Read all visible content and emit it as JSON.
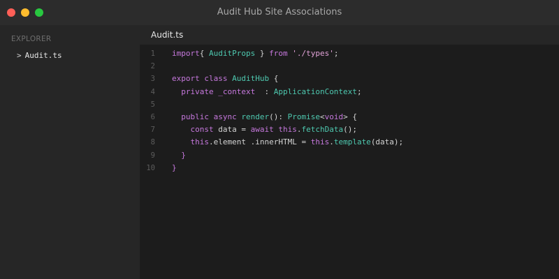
{
  "window": {
    "title": "Audit Hub Site Associations",
    "controls": {
      "close_color": "#ff5f57",
      "minimize_color": "#febc2e",
      "zoom_color": "#28c840"
    }
  },
  "sidebar": {
    "heading": "EXPLORER",
    "items": [
      {
        "chevron": ">",
        "label": "Audit.ts",
        "icon": "chevron-right-icon"
      }
    ]
  },
  "editor": {
    "tabs": [
      {
        "label": "Audit.ts",
        "active": true
      }
    ],
    "lines": [
      {
        "n": "1",
        "tokens": [
          {
            "t": "import",
            "c": "kw"
          },
          {
            "t": "{ ",
            "c": "pl"
          },
          {
            "t": "AuditProps",
            "c": "ty"
          },
          {
            "t": " } ",
            "c": "pl"
          },
          {
            "t": "from",
            "c": "kw"
          },
          {
            "t": " ",
            "c": "pl"
          },
          {
            "t": "'./types'",
            "c": "str"
          },
          {
            "t": ";",
            "c": "pl"
          }
        ]
      },
      {
        "n": "2",
        "tokens": []
      },
      {
        "n": "3",
        "tokens": [
          {
            "t": "export",
            "c": "kw"
          },
          {
            "t": " ",
            "c": "pl"
          },
          {
            "t": "class",
            "c": "kw"
          },
          {
            "t": " ",
            "c": "pl"
          },
          {
            "t": "AuditHub",
            "c": "ty"
          },
          {
            "t": " {",
            "c": "pl"
          }
        ]
      },
      {
        "n": "4",
        "tokens": [
          {
            "t": "  ",
            "c": "pl"
          },
          {
            "t": "private",
            "c": "kw"
          },
          {
            "t": " ",
            "c": "pl"
          },
          {
            "t": "_context",
            "c": "kw"
          },
          {
            "t": "  : ",
            "c": "pl"
          },
          {
            "t": "ApplicationContext",
            "c": "ty"
          },
          {
            "t": ";",
            "c": "pl"
          }
        ]
      },
      {
        "n": "5",
        "tokens": []
      },
      {
        "n": "6",
        "tokens": [
          {
            "t": "  ",
            "c": "pl"
          },
          {
            "t": "public",
            "c": "kw"
          },
          {
            "t": " ",
            "c": "pl"
          },
          {
            "t": "async",
            "c": "kw"
          },
          {
            "t": " ",
            "c": "pl"
          },
          {
            "t": "render",
            "c": "fn"
          },
          {
            "t": "(): ",
            "c": "pl"
          },
          {
            "t": "Promise",
            "c": "ty"
          },
          {
            "t": "<",
            "c": "pl"
          },
          {
            "t": "void",
            "c": "kw"
          },
          {
            "t": "> {",
            "c": "pl"
          }
        ]
      },
      {
        "n": "7",
        "tokens": [
          {
            "t": "    ",
            "c": "pl"
          },
          {
            "t": "const",
            "c": "kw"
          },
          {
            "t": " data = ",
            "c": "pl"
          },
          {
            "t": "await",
            "c": "kw"
          },
          {
            "t": " ",
            "c": "pl"
          },
          {
            "t": "this",
            "c": "kw"
          },
          {
            "t": ".",
            "c": "pl"
          },
          {
            "t": "fetchData",
            "c": "fn"
          },
          {
            "t": "();",
            "c": "pl"
          }
        ]
      },
      {
        "n": "8",
        "tokens": [
          {
            "t": "    ",
            "c": "pl"
          },
          {
            "t": "this",
            "c": "kw"
          },
          {
            "t": ".element .innerHTML = ",
            "c": "pl"
          },
          {
            "t": "this",
            "c": "kw"
          },
          {
            "t": ".",
            "c": "pl"
          },
          {
            "t": "template",
            "c": "fn"
          },
          {
            "t": "(data);",
            "c": "pl"
          }
        ]
      },
      {
        "n": "9",
        "tokens": [
          {
            "t": "  }",
            "c": "kw"
          }
        ]
      },
      {
        "n": "10",
        "tokens": [
          {
            "t": "}",
            "c": "kw"
          }
        ]
      }
    ]
  }
}
